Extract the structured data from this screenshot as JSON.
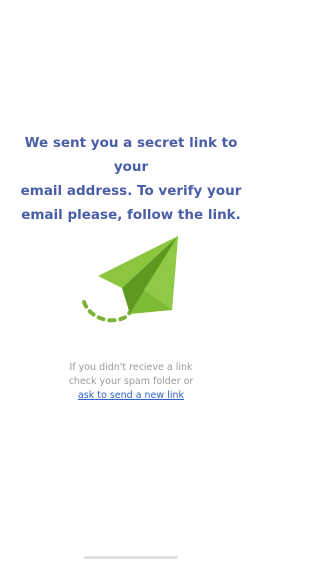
{
  "message": {
    "line1": "We sent you a secret link to your",
    "line2": "email address. To verify your",
    "line3": "email please, follow the link."
  },
  "illustration": {
    "icon": "paper-plane-icon",
    "colors": {
      "light": "#8cc63f",
      "mid": "#76b12e",
      "dark": "#5e9a1f"
    }
  },
  "help": {
    "line1": "If you didn't recieve a link",
    "line2": "check your spam folder or",
    "link_label": "ask to send a new link"
  },
  "colors": {
    "headline": "#4a5ea8",
    "link": "#2f63c8",
    "help_text": "#9a9a9a"
  }
}
